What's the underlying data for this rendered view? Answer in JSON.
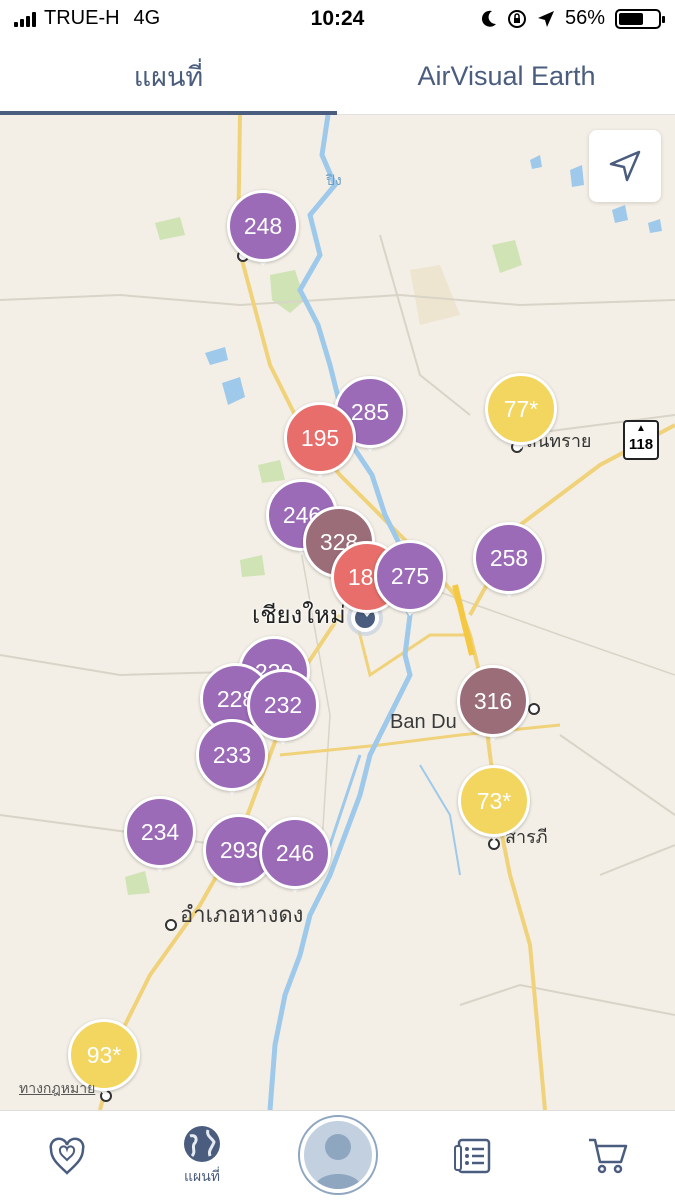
{
  "status_bar": {
    "carrier": "TRUE-H",
    "network": "4G",
    "time": "10:24",
    "battery": "56%"
  },
  "tabs": [
    {
      "label": "แผนที่",
      "active": true
    },
    {
      "label": "AirVisual Earth",
      "active": false
    }
  ],
  "map": {
    "labels": {
      "city": "เชียงใหม่",
      "ban_du": "Ban Du",
      "hang_dong": "อำเภอหางดง",
      "san_sai": "สันทราย",
      "saraphi": "สารภี",
      "river": "ปิง",
      "highway": "118",
      "legal": "ทางกฎหมาย"
    },
    "aqi_pins": [
      {
        "value": "248",
        "color": "#9b6bb8"
      },
      {
        "value": "285",
        "color": "#9b6bb8"
      },
      {
        "value": "195",
        "color": "#e76e6a"
      },
      {
        "value": "77*",
        "color": "#f2d660"
      },
      {
        "value": "246",
        "color": "#9b6bb8"
      },
      {
        "value": "328",
        "color": "#9a6d78"
      },
      {
        "value": "181",
        "color": "#e76e6a"
      },
      {
        "value": "275",
        "color": "#9b6bb8"
      },
      {
        "value": "258",
        "color": "#9b6bb8"
      },
      {
        "value": "230",
        "color": "#9b6bb8"
      },
      {
        "value": "228",
        "color": "#9b6bb8"
      },
      {
        "value": "232",
        "color": "#9b6bb8"
      },
      {
        "value": "316",
        "color": "#9a6d78"
      },
      {
        "value": "233",
        "color": "#9b6bb8"
      },
      {
        "value": "73*",
        "color": "#f2d660"
      },
      {
        "value": "234",
        "color": "#9b6bb8"
      },
      {
        "value": "293",
        "color": "#9b6bb8"
      },
      {
        "value": "246",
        "color": "#9b6bb8"
      },
      {
        "value": "93*",
        "color": "#f2d660"
      }
    ]
  },
  "bottom_nav": {
    "map_label": "แผนที่"
  },
  "colors": {
    "accent": "#4a5d7e",
    "map_background": "#f3efe6",
    "water": "#9ec9ea",
    "road_major": "#f0d27a"
  }
}
